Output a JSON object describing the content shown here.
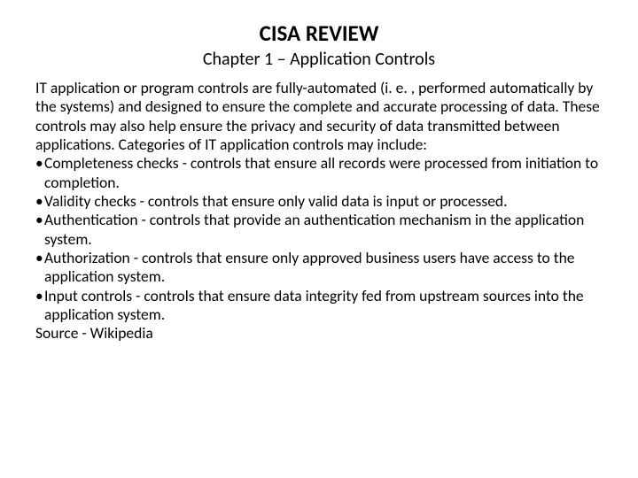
{
  "title": "CISA REVIEW",
  "subtitle": "Chapter 1 – Application Controls",
  "intro": "IT application or program controls are fully-automated (i. e. , performed automatically by the systems) and designed to ensure the complete and accurate processing of data. These controls may also help ensure the privacy and security of data transmitted between applications. Categories of IT application controls may include:",
  "bullets": [
    "Completeness checks - controls that ensure all records were processed from initiation to completion.",
    "Validity checks - controls that ensure only valid data is input or processed.",
    "Authentication - controls that provide an authentication mechanism in the application system.",
    "Authorization - controls that ensure only approved business users have access to the application system.",
    "Input controls - controls that ensure data integrity fed from upstream sources into the application system."
  ],
  "source": "Source - Wikipedia"
}
